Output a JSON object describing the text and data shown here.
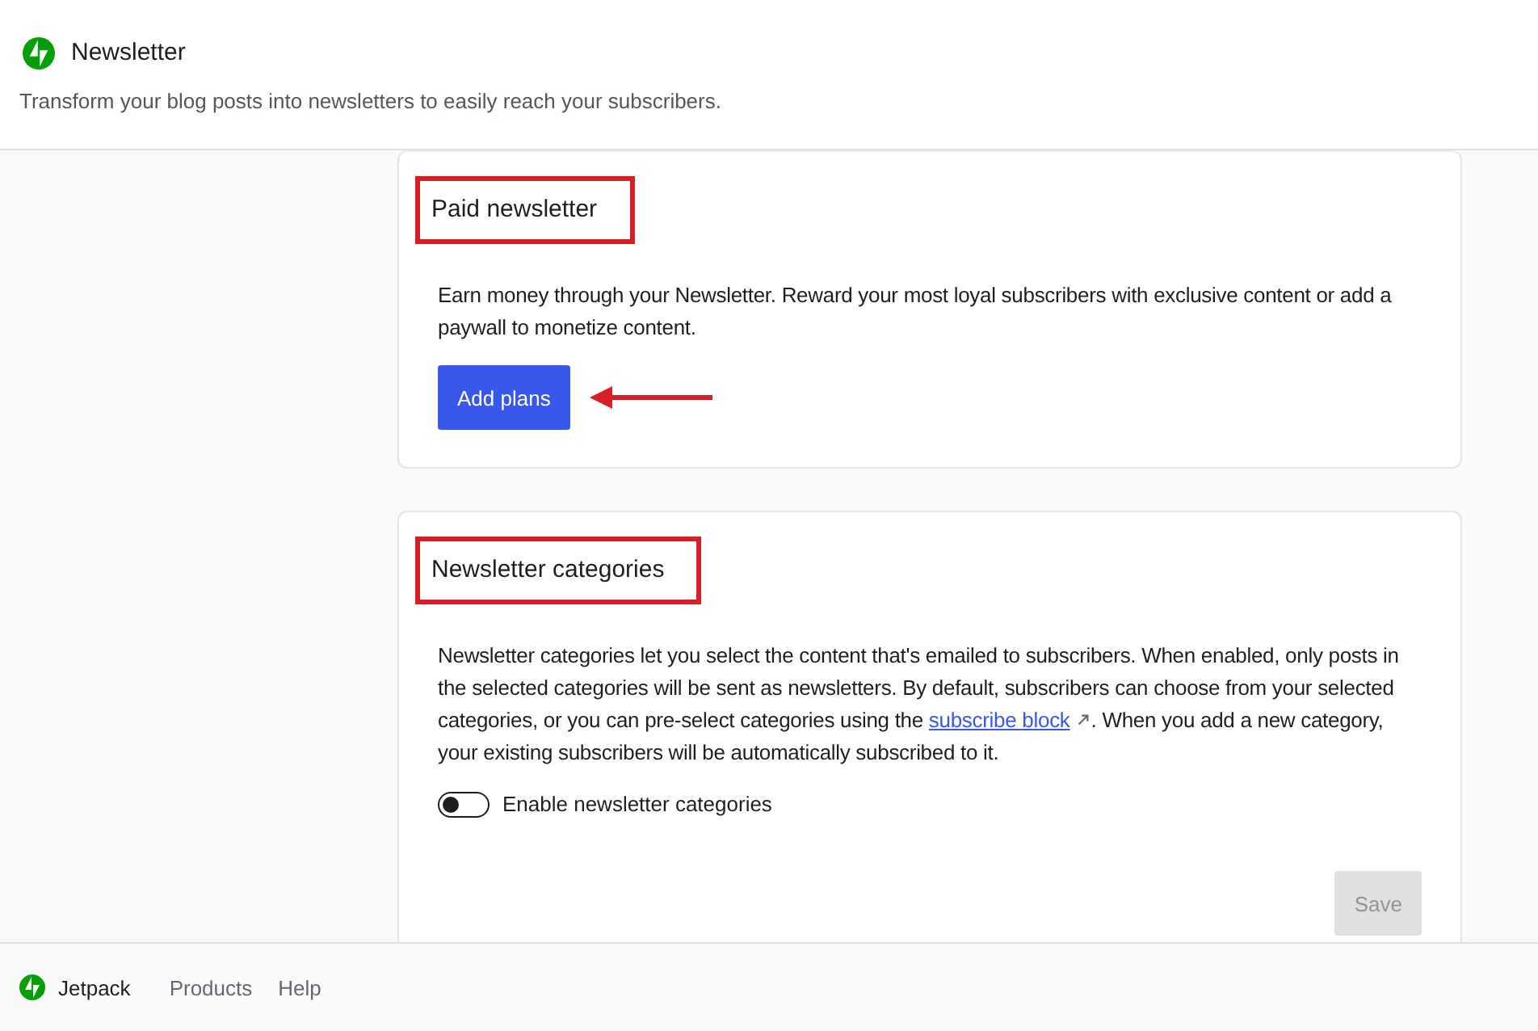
{
  "header": {
    "title": "Newsletter",
    "subtitle": "Transform your blog posts into newsletters to easily reach your subscribers."
  },
  "cards": [
    {
      "kind": "action",
      "title": "Paid newsletter",
      "highlighted": true,
      "description": "Earn money through your Newsletter. Reward your most loyal subscribers with exclusive content or add a paywall to monetize content.",
      "button": {
        "label": "Add plans",
        "disabled": false,
        "pointer_arrow": true
      }
    },
    {
      "kind": "setting",
      "title": "Newsletter categories",
      "highlighted": true,
      "description": "Newsletter categories let you select the content that's emailed to subscribers. When enabled, only posts in the selected categories will be sent as newsletters. By default, subscribers can choose from your selected categories, or you can pre-select categories using the ",
      "link": {
        "label": "subscribe block"
      },
      "description_after": ". When you add a new category, your existing subscribers will be automatically subscribed to it.",
      "toggle": {
        "label": "Enable newsletter categories",
        "on": false
      },
      "button": {
        "label": "Save",
        "disabled": true
      }
    }
  ],
  "footer": {
    "brand": "Jetpack",
    "links": [
      "Products",
      "Help"
    ]
  }
}
